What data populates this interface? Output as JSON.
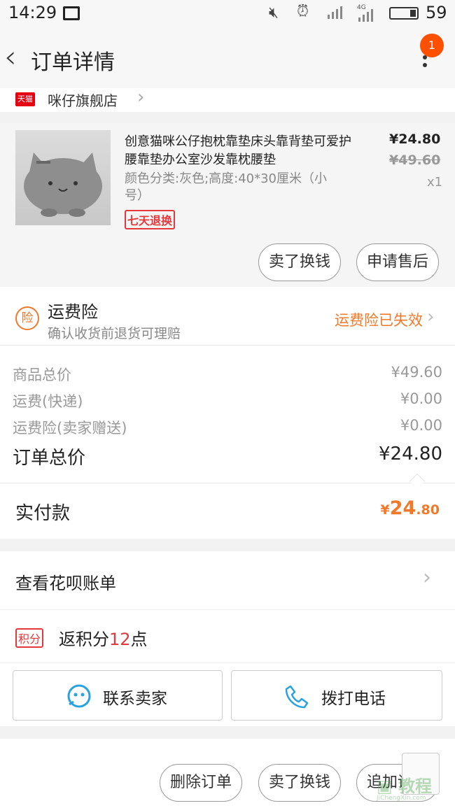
{
  "status_bar": {
    "time": "14:29",
    "battery": "59",
    "network": "4G"
  },
  "header": {
    "title": "订单详情",
    "notification_count": "1"
  },
  "store": {
    "logo_text": "天猫",
    "name": "咪仔旗舰店"
  },
  "product": {
    "title": "创意猫咪公仔抱枕靠垫床头靠背垫可爱护腰靠垫办公室沙发靠枕腰垫",
    "spec": "颜色分类:灰色;高度:40*30厘米（小号）",
    "tag": "七天退换",
    "price": "¥24.80",
    "original_price": "¥49.60",
    "quantity": "x1",
    "btn_sell": "卖了换钱",
    "btn_after_sale": "申请售后"
  },
  "insurance": {
    "icon": "险",
    "title": "运费险",
    "subtitle": "确认收货前退货可理赔",
    "status": "运费险已失效"
  },
  "breakdown": {
    "rows": [
      {
        "label": "商品总价",
        "value": "¥49.60"
      },
      {
        "label": "运费(快递)",
        "value": "¥0.00"
      },
      {
        "label": "运费险(卖家赠送)",
        "value": "¥0.00"
      }
    ],
    "total_label": "订单总价",
    "total_value": "¥24.80"
  },
  "paid": {
    "label": "实付款",
    "currency": "¥",
    "int": "24",
    "dec": ".80"
  },
  "huabei": {
    "label": "查看花呗账单"
  },
  "points": {
    "tag": "积分",
    "prefix": "返积分",
    "num": "12",
    "suffix": "点"
  },
  "contacts": {
    "seller": "联系卖家",
    "phone": "拨打电话"
  },
  "bottom": {
    "delete": "删除订单",
    "sell": "卖了换钱",
    "review": "追加评价"
  },
  "watermark": {
    "text": "JiChengXin.com"
  },
  "colors": {
    "accent": "#f07a2a",
    "tmall_red": "#e60012",
    "badge": "#ff5000",
    "icon_blue": "#29a3e0"
  }
}
